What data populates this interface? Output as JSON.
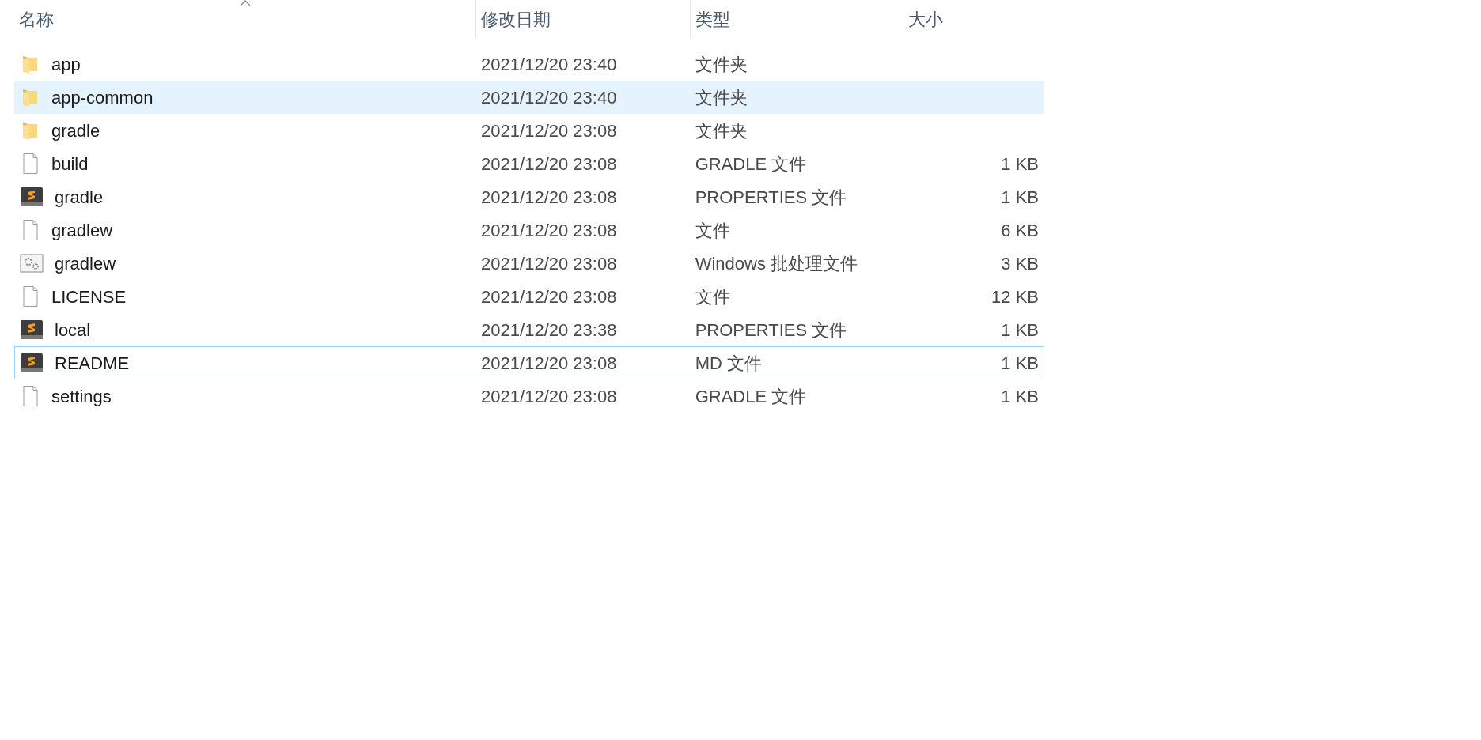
{
  "columns": [
    {
      "label": "名称",
      "sorted": true
    },
    {
      "label": "修改日期",
      "sorted": false
    },
    {
      "label": "类型",
      "sorted": false
    },
    {
      "label": "大小",
      "sorted": false
    }
  ],
  "files": [
    {
      "name": "app",
      "modified": "2021/12/20 23:40",
      "type": "文件夹",
      "kind": "folder",
      "hovered": false,
      "focused": false
    },
    {
      "name": "app-common",
      "modified": "2021/12/20 23:40",
      "type": "文件夹",
      "kind": "folder",
      "hovered": true,
      "focused": false
    },
    {
      "name": "gradle",
      "modified": "2021/12/20 23:08",
      "type": "文件夹",
      "kind": "folder",
      "hovered": false,
      "focused": false
    },
    {
      "name": "build",
      "modified": "2021/12/20 23:08",
      "type": "GRADLE 文件",
      "size": "1 KB",
      "kind": "file",
      "hovered": false,
      "focused": false
    },
    {
      "name": "gradle",
      "modified": "2021/12/20 23:08",
      "type": "PROPERTIES 文件",
      "size": "1 KB",
      "kind": "editor",
      "hovered": false,
      "focused": false
    },
    {
      "name": "gradlew",
      "modified": "2021/12/20 23:08",
      "type": "文件",
      "size": "6 KB",
      "kind": "file",
      "hovered": false,
      "focused": false
    },
    {
      "name": "gradlew",
      "modified": "2021/12/20 23:08",
      "type": "Windows 批处理文件",
      "size": "3 KB",
      "kind": "batch",
      "hovered": false,
      "focused": false
    },
    {
      "name": "LICENSE",
      "modified": "2021/12/20 23:08",
      "type": "文件",
      "size": "12 KB",
      "kind": "file",
      "hovered": false,
      "focused": false
    },
    {
      "name": "local",
      "modified": "2021/12/20 23:38",
      "type": "PROPERTIES 文件",
      "size": "1 KB",
      "kind": "editor",
      "hovered": false,
      "focused": false
    },
    {
      "name": "README",
      "modified": "2021/12/20 23:08",
      "type": "MD 文件",
      "size": "1 KB",
      "kind": "editor",
      "hovered": false,
      "focused": true
    },
    {
      "name": "settings",
      "modified": "2021/12/20 23:08",
      "type": "GRADLE 文件",
      "size": "1 KB",
      "kind": "file",
      "hovered": false,
      "focused": false
    }
  ]
}
